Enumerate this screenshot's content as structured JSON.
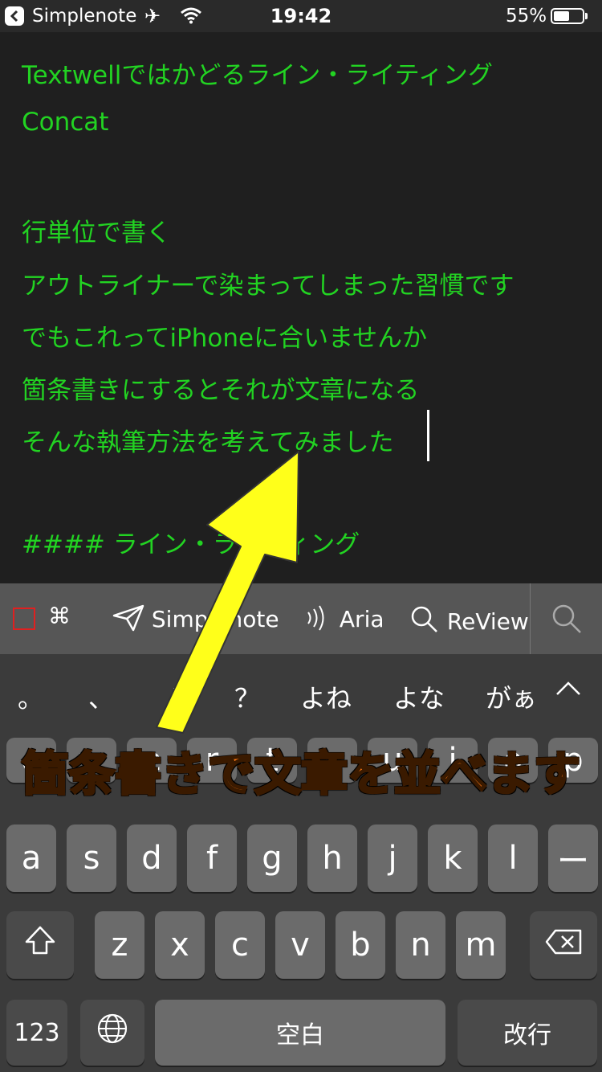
{
  "status_bar": {
    "back_label": "Simplenote",
    "time": "19:42",
    "battery_percent": "55%",
    "battery_level": 0.55
  },
  "editor": {
    "lines": [
      "Textwellではかどるライン・ライティング",
      "Concat",
      "行単位で書く",
      "アウトライナーで染まってしまった習慣です",
      "でもこれってiPhoneに合いませんか",
      "箇条書きにするとそれが文章になる",
      "そんな執筆方法を考えてみました",
      "#### ライン・ライティング"
    ]
  },
  "toolbar": {
    "cmd_glyph": "⌘",
    "simplenote_label": "Simplenote",
    "aria_label": "Aria",
    "review_label": "ReView"
  },
  "keyboard": {
    "candidates": [
      "。",
      "、",
      "！",
      "？",
      "よね",
      "よな",
      "がぁ"
    ],
    "row_top_visible": [
      "q",
      "w",
      "e",
      "r",
      "t",
      "y",
      "u",
      "i",
      "o",
      "p"
    ],
    "row_home": [
      "a",
      "s",
      "d",
      "f",
      "g",
      "h",
      "j",
      "k",
      "l",
      "ー"
    ],
    "row_bottom": [
      "z",
      "x",
      "c",
      "v",
      "b",
      "n",
      "m"
    ],
    "numbers_label": "123",
    "space_label": "空白",
    "return_label": "改行"
  },
  "annotation": {
    "caption": "箇条書きで文章を並べます",
    "arrow_color": "#ffff1a",
    "caption_color": "#ff7a14"
  },
  "colors": {
    "editor_text": "#22d322",
    "background": "#1f1f1f"
  }
}
